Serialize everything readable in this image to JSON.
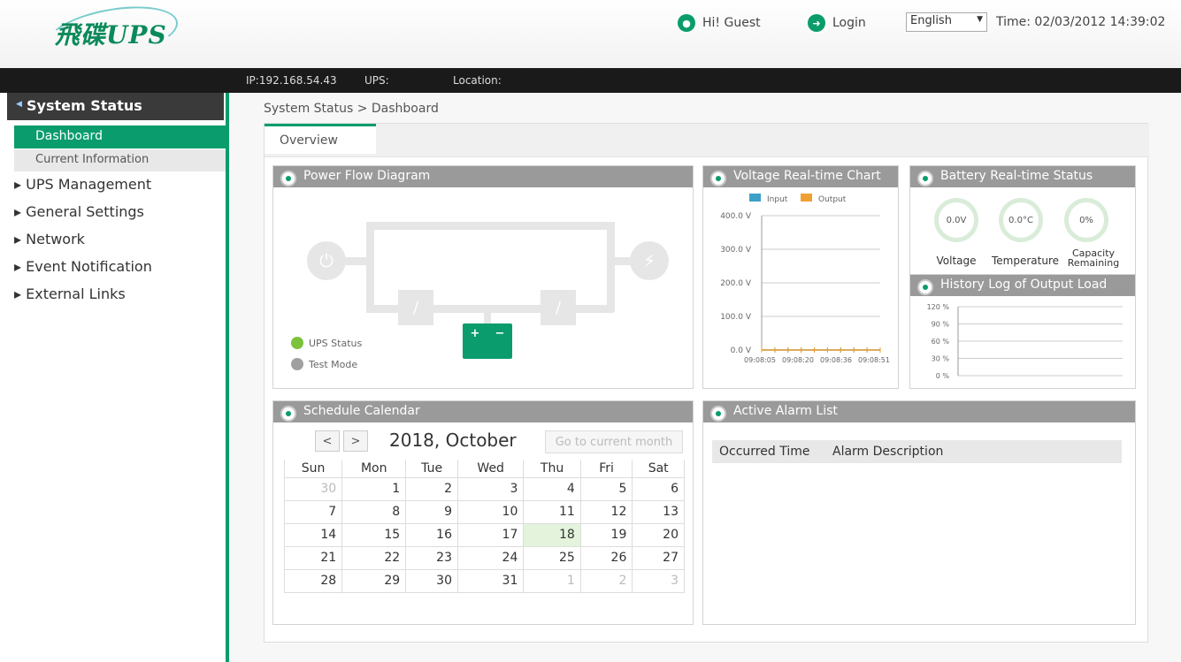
{
  "header": {
    "logo_text": "飛碟UPS",
    "greeting": "Hi! Guest",
    "login_label": "Login",
    "language": "English",
    "time": "Time: 02/03/2012 14:39:02"
  },
  "infobar": {
    "ip": "IP:192.168.54.43",
    "ups": "UPS:",
    "location": "Location:"
  },
  "sidebar": {
    "section": "System Status",
    "sub_items": [
      "Dashboard",
      "Current Information"
    ],
    "items": [
      "UPS Management",
      "General Settings",
      "Network",
      "Event Notification",
      "External Links"
    ]
  },
  "breadcrumb": "System Status > Dashboard",
  "tabs": [
    "Overview"
  ],
  "power_flow": {
    "title": "Power Flow Diagram",
    "legend": [
      {
        "label": "UPS Status",
        "color": "#7cc23a"
      },
      {
        "label": "Test Mode",
        "color": "#a0a0a0"
      }
    ]
  },
  "voltage_chart": {
    "title": "Voltage Real-time Chart",
    "chart_data": {
      "type": "line",
      "series": [
        {
          "name": "Input",
          "color": "#3ca0c8",
          "values": [
            0,
            0,
            0,
            0,
            0,
            0,
            0,
            0,
            0,
            0
          ]
        },
        {
          "name": "Output",
          "color": "#f0a030",
          "values": [
            0,
            0,
            0,
            0,
            0,
            0,
            0,
            0,
            0,
            0
          ]
        }
      ],
      "y_ticks": [
        "400.0 V",
        "300.0 V",
        "200.0 V",
        "100.0 V",
        "0.0 V"
      ],
      "x_ticks": [
        "09:08:05",
        "09:08:20",
        "09:08:36",
        "09:08:51"
      ],
      "ylim": [
        0,
        400
      ]
    }
  },
  "battery": {
    "title": "Battery Real-time Status",
    "gauges": [
      {
        "value": "0.0V",
        "label": "Voltage"
      },
      {
        "value": "0.0°C",
        "label": "Temperature"
      },
      {
        "value": "0%",
        "label": "Capacity Remaining"
      }
    ]
  },
  "history": {
    "title": "History Log of Output Load",
    "chart_data": {
      "type": "line",
      "y_ticks": [
        "120 %",
        "90 %",
        "60 %",
        "30 %",
        "0 %"
      ],
      "ylim": [
        0,
        120
      ]
    }
  },
  "calendar": {
    "title": "Schedule Calendar",
    "month_label": "2018, October",
    "prev": "<",
    "next": ">",
    "go_current": "Go to current month",
    "weekdays": [
      "Sun",
      "Mon",
      "Tue",
      "Wed",
      "Thu",
      "Fri",
      "Sat"
    ],
    "weeks": [
      [
        "30",
        "1",
        "2",
        "3",
        "4",
        "5",
        "6"
      ],
      [
        "7",
        "8",
        "9",
        "10",
        "11",
        "12",
        "13"
      ],
      [
        "14",
        "15",
        "16",
        "17",
        "18",
        "19",
        "20"
      ],
      [
        "21",
        "22",
        "23",
        "24",
        "25",
        "26",
        "27"
      ],
      [
        "28",
        "29",
        "30",
        "31",
        "1",
        "2",
        "3"
      ]
    ],
    "today": "18"
  },
  "alarms": {
    "title": "Active Alarm List",
    "columns": [
      "Occurred Time",
      "Alarm Description"
    ]
  }
}
